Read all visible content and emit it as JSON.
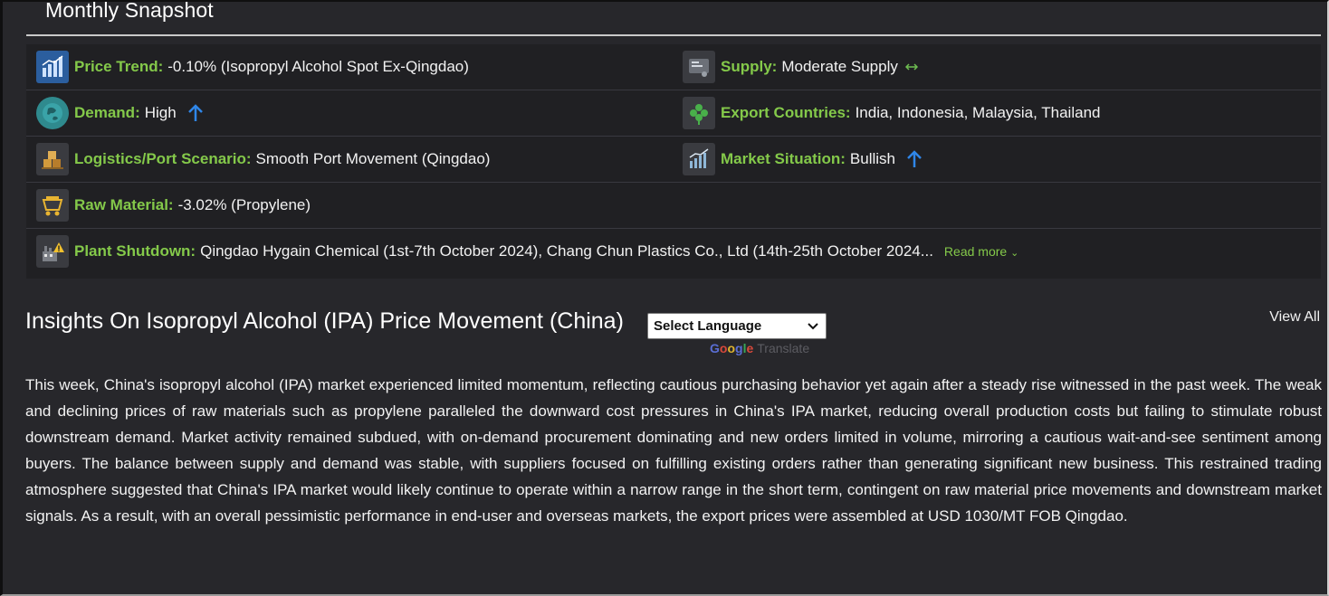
{
  "snapshot": {
    "title": "Monthly Snapshot",
    "price_trend": {
      "label": "Price Trend:",
      "value": "-0.10% (Isopropyl Alcohol Spot Ex-Qingdao)"
    },
    "supply": {
      "label": "Supply:",
      "value": "Moderate Supply"
    },
    "demand": {
      "label": "Demand:",
      "value": "High"
    },
    "export_countries": {
      "label": "Export Countries:",
      "value": "India, Indonesia, Malaysia, Thailand"
    },
    "logistics": {
      "label": "Logistics/Port Scenario:",
      "value": "Smooth Port Movement (Qingdao)"
    },
    "market_situation": {
      "label": "Market Situation:",
      "value": "Bullish"
    },
    "raw_material": {
      "label": "Raw Material:",
      "value": "-3.02% (Propylene)"
    },
    "plant_shutdown": {
      "label": "Plant Shutdown:",
      "value": "Qingdao Hygain Chemical (1st-7th October 2024), Chang Chun Plastics Co., Ltd (14th-25th October 2024...",
      "read_more": "Read more"
    }
  },
  "insights": {
    "title": "Insights On Isopropyl Alcohol (IPA) Price Movement (China)",
    "language_select": "Select Language",
    "google": [
      "G",
      "o",
      "o",
      "g",
      "l",
      "e"
    ],
    "translate": "Translate",
    "view_all": "View All",
    "paragraph": "This week, China's isopropyl alcohol (IPA) market experienced limited momentum, reflecting cautious purchasing behavior yet again after a steady rise witnessed in the past week. The weak and declining prices of raw materials such as propylene paralleled the downward cost pressures in China's IPA market, reducing overall production costs but failing to stimulate robust downstream demand. Market activity remained subdued, with on-demand procurement dominating and new orders limited in volume, mirroring a cautious wait-and-see sentiment among buyers. The balance between supply and demand was stable, with suppliers focused on fulfilling existing orders rather than generating significant new business. This restrained trading atmosphere suggested that China's IPA market would likely continue to operate within a narrow range in the short term, contingent on raw material price movements and downstream market signals. As a result, with an overall pessimistic performance in end-user and overseas markets, the export prices were assembled at USD 1030/MT FOB Qingdao."
  },
  "colors": {
    "label_green": "#84c94a",
    "arrow_blue": "#2f86e8",
    "background": "#27272b",
    "snapshot_bg": "#202023"
  },
  "icons": {
    "price_trend": "bar-chart-icon",
    "supply": "supply-icon",
    "demand": "demand-globe-icon",
    "export": "export-leaf-icon",
    "logistics": "logistics-boxes-icon",
    "market": "market-chart-icon",
    "raw_material": "raw-material-cart-icon",
    "plant_shutdown": "plant-warning-icon"
  }
}
